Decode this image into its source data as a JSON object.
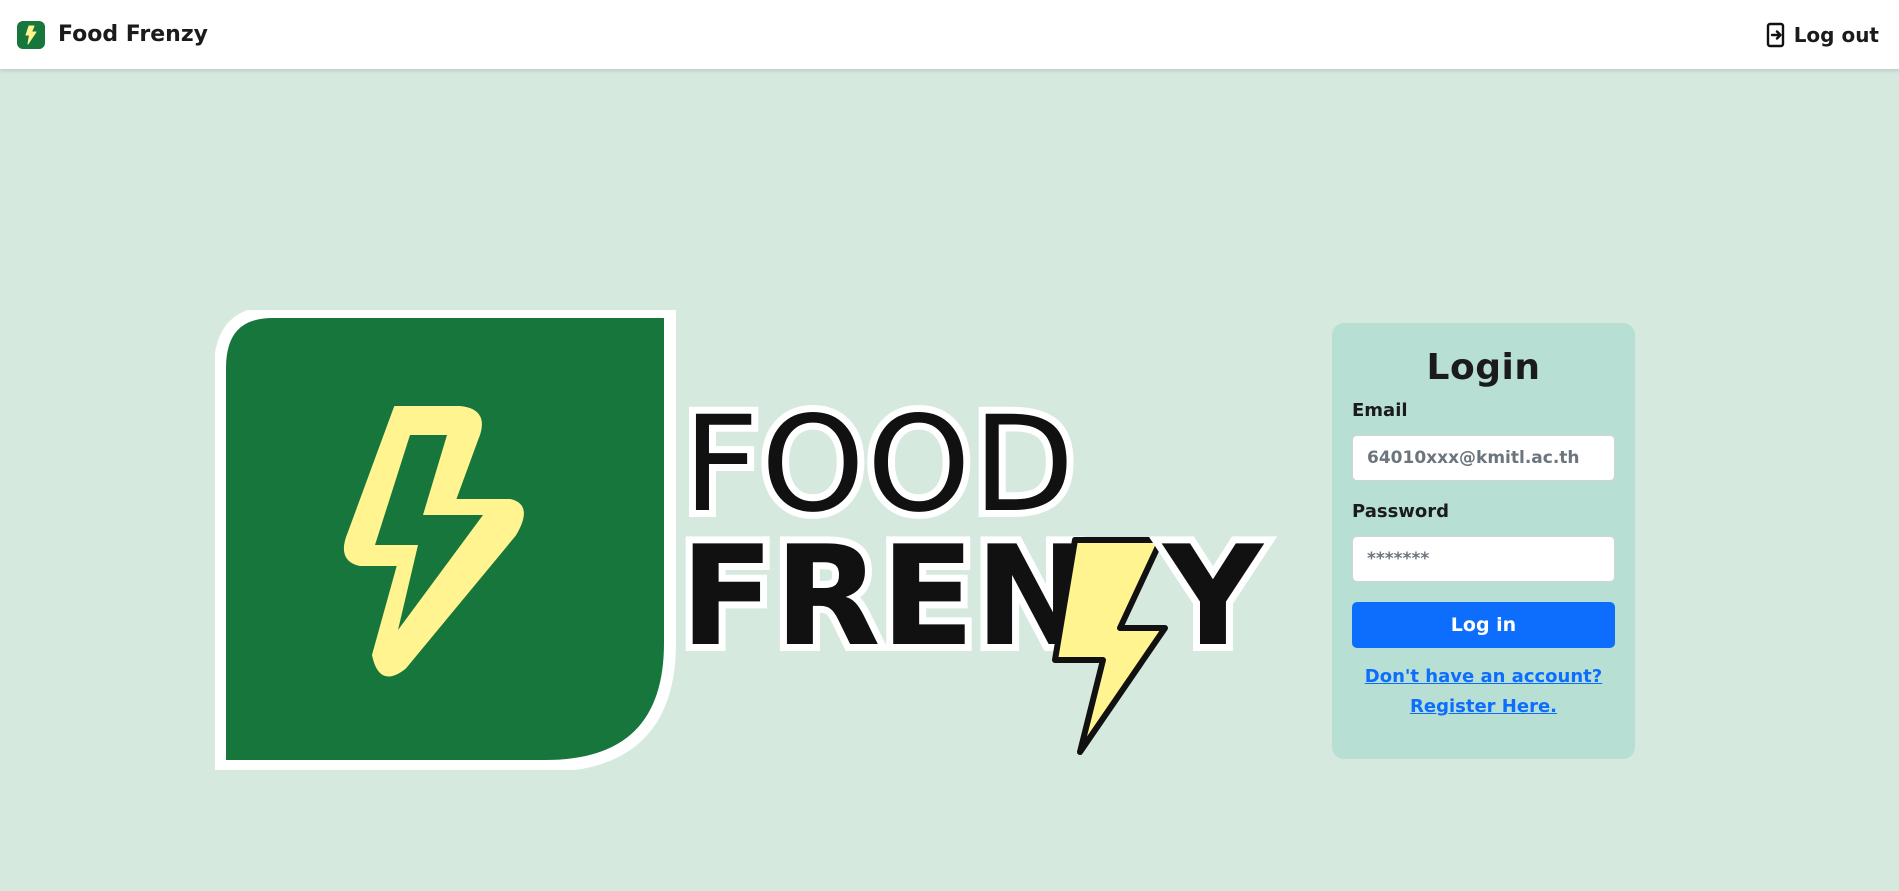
{
  "navbar": {
    "brand": "Food Frenzy",
    "logout_label": "Log out"
  },
  "hero": {
    "logo_line1": "FOOD",
    "logo_line2_a": "FREN",
    "logo_line2_b": "Y"
  },
  "login": {
    "title": "Login",
    "email_label": "Email",
    "email_placeholder": "64010xxx@kmitl.ac.th",
    "password_label": "Password",
    "password_placeholder": "*******",
    "button_label": "Log in",
    "no_account_link": "Don't have an account?",
    "register_link": "Register Here."
  },
  "colors": {
    "page_bg": "#d5e9df",
    "brand_green": "#16763c",
    "bolt_yellow": "#fff48f",
    "card_bg": "#b7dfd3",
    "primary_blue": "#0d6efd"
  },
  "icons": {
    "brand": "lightning-bolt-icon",
    "logout": "logout-door-icon"
  }
}
